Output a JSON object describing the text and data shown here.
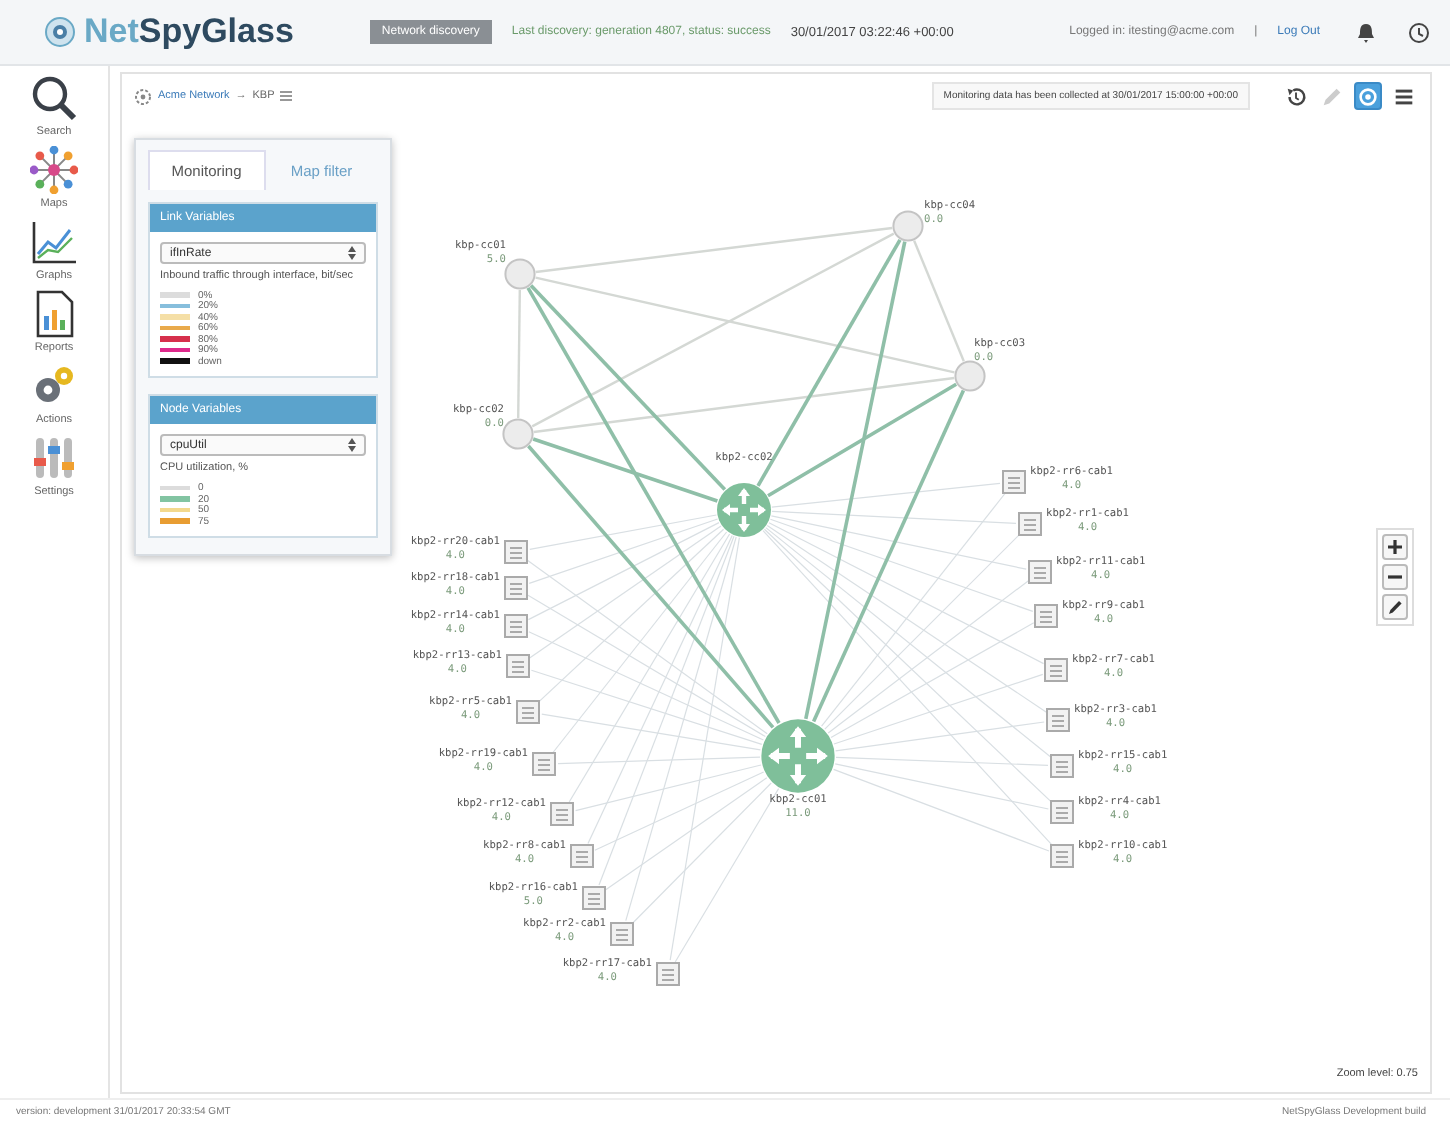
{
  "header": {
    "logo_first": "Net",
    "logo_second": "SpyGlass",
    "badge": "Network discovery",
    "status": "Last discovery: generation 4807, status: success",
    "timestamp": "30/01/2017 03:22:46 +00:00",
    "login_text": "Logged in: itesting@acme.com",
    "login_separator": "|",
    "logout": "Log Out"
  },
  "sidebar": {
    "items": [
      {
        "kind": "search",
        "label": "Search"
      },
      {
        "kind": "maps",
        "label": "Maps"
      },
      {
        "kind": "graphs",
        "label": "Graphs"
      },
      {
        "kind": "reports",
        "label": "Reports"
      },
      {
        "kind": "actions",
        "label": "Actions"
      },
      {
        "kind": "settings",
        "label": "Settings"
      }
    ]
  },
  "breadcrumb": {
    "root": "Acme Network",
    "separator": "→",
    "current": "KBP"
  },
  "notice": "Monitoring data has been collected at 30/01/2017 15:00:00 +00:00",
  "toolbar": [
    {
      "kind": "history",
      "selected": false,
      "disabled": false
    },
    {
      "kind": "edit",
      "selected": false,
      "disabled": true
    },
    {
      "kind": "view",
      "selected": true,
      "disabled": false
    },
    {
      "kind": "menu",
      "selected": false,
      "disabled": false
    }
  ],
  "filter_panel": {
    "tabs": [
      {
        "label": "Monitoring",
        "selected": true
      },
      {
        "label": "Map filter",
        "selected": false
      }
    ],
    "sections": [
      {
        "title": "Link Variables",
        "select": "ifInRate",
        "description": "Inbound traffic through interface, bit/sec",
        "legend": [
          {
            "label": "0%",
            "color": "#dcdcdc"
          },
          {
            "label": "20%",
            "color": "#86bedc"
          },
          {
            "label": "40%",
            "color": "#f5dfa6"
          },
          {
            "label": "60%",
            "color": "#e9aa4c"
          },
          {
            "label": "80%",
            "color": "#d6304c"
          },
          {
            "label": "90%",
            "color": "#de2a8c"
          },
          {
            "label": "down",
            "color": "#111111"
          }
        ]
      },
      {
        "title": "Node Variables",
        "select": "cpuUtil",
        "description": "CPU utilization, %",
        "legend": [
          {
            "label": "0",
            "color": "#dcdcdc"
          },
          {
            "label": "20",
            "color": "#82c4a2"
          },
          {
            "label": "50",
            "color": "#f3d98d"
          },
          {
            "label": "75",
            "color": "#e89d32"
          }
        ]
      }
    ]
  },
  "map": {
    "nodes": [
      {
        "kind": "core",
        "name": "kbp-cc04",
        "value": "0.0"
      },
      {
        "kind": "core",
        "name": "kbp-cc01",
        "value": "5.0"
      },
      {
        "kind": "core",
        "name": "kbp-cc03",
        "value": "0.0"
      },
      {
        "kind": "core",
        "name": "kbp-cc02",
        "value": "0.0"
      },
      {
        "kind": "router",
        "name": "kbp2-cc02"
      },
      {
        "kind": "router",
        "name": "kbp2-cc01",
        "value": "11.0"
      },
      {
        "kind": "leaf",
        "name": "kbp2-rr20-cab1",
        "value": "4.0"
      },
      {
        "kind": "leaf",
        "name": "kbp2-rr18-cab1",
        "value": "4.0"
      },
      {
        "kind": "leaf",
        "name": "kbp2-rr14-cab1",
        "value": "4.0"
      },
      {
        "kind": "leaf",
        "name": "kbp2-rr13-cab1",
        "value": "4.0"
      },
      {
        "kind": "leaf",
        "name": "kbp2-rr5-cab1",
        "value": "4.0"
      },
      {
        "kind": "leaf",
        "name": "kbp2-rr19-cab1",
        "value": "4.0"
      },
      {
        "kind": "leaf",
        "name": "kbp2-rr12-cab1",
        "value": "4.0"
      },
      {
        "kind": "leaf",
        "name": "kbp2-rr8-cab1",
        "value": "4.0"
      },
      {
        "kind": "leaf",
        "name": "kbp2-rr16-cab1",
        "value": "5.0"
      },
      {
        "kind": "leaf",
        "name": "kbp2-rr2-cab1",
        "value": "4.0"
      },
      {
        "kind": "leaf",
        "name": "kbp2-rr17-cab1",
        "value": "4.0"
      },
      {
        "kind": "leaf",
        "name": "kbp2-rr6-cab1",
        "value": "4.0"
      },
      {
        "kind": "leaf",
        "name": "kbp2-rr1-cab1",
        "value": "4.0"
      },
      {
        "kind": "leaf",
        "name": "kbp2-rr11-cab1",
        "value": "4.0"
      },
      {
        "kind": "leaf",
        "name": "kbp2-rr9-cab1",
        "value": "4.0"
      },
      {
        "kind": "leaf",
        "name": "kbp2-rr7-cab1",
        "value": "4.0"
      },
      {
        "kind": "leaf",
        "name": "kbp2-rr3-cab1",
        "value": "4.0"
      },
      {
        "kind": "leaf",
        "name": "kbp2-rr15-cab1",
        "value": "4.0"
      },
      {
        "kind": "leaf",
        "name": "kbp2-rr4-cab1",
        "value": "4.0"
      },
      {
        "kind": "leaf",
        "name": "kbp2-rr10-cab1",
        "value": "4.0"
      }
    ],
    "zoom_level": "Zoom level: 0.75"
  },
  "footer": {
    "version": "version: development 31/01/2017 20:33:54 GMT",
    "build": "NetSpyGlass Development build"
  }
}
